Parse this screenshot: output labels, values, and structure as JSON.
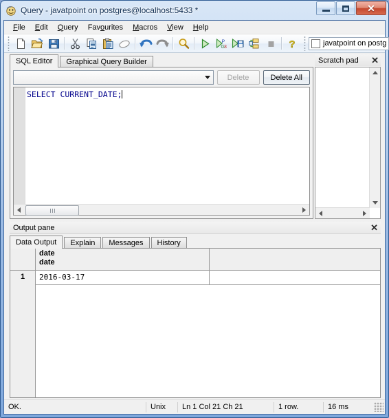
{
  "window": {
    "title": "Query - javatpoint on postgres@localhost:5433 *",
    "icon": "query-window-icon",
    "caption_buttons": [
      {
        "name": "minimize-button",
        "glyph": "minimize"
      },
      {
        "name": "maximize-button",
        "glyph": "maximize"
      },
      {
        "name": "close-button",
        "glyph": "✕"
      }
    ]
  },
  "menubar": {
    "items": [
      {
        "pre": "",
        "accel": "F",
        "post": "ile"
      },
      {
        "pre": "",
        "accel": "E",
        "post": "dit"
      },
      {
        "pre": "",
        "accel": "Q",
        "post": "uery"
      },
      {
        "pre": "Fav",
        "accel": "o",
        "post": "urites"
      },
      {
        "pre": "",
        "accel": "M",
        "post": "acros"
      },
      {
        "pre": "",
        "accel": "V",
        "post": "iew"
      },
      {
        "pre": "",
        "accel": "H",
        "post": "elp"
      }
    ]
  },
  "toolbar": {
    "buttons": [
      {
        "name": "new-file-icon",
        "title": "New"
      },
      {
        "name": "open-file-icon",
        "title": "Open"
      },
      {
        "name": "save-icon",
        "title": "Save"
      },
      {
        "name": "cut-icon",
        "title": "Cut"
      },
      {
        "name": "copy-icon",
        "title": "Copy"
      },
      {
        "name": "paste-icon",
        "title": "Paste"
      },
      {
        "name": "clear-window-icon",
        "title": "Clear window"
      },
      {
        "name": "undo-icon",
        "title": "Undo"
      },
      {
        "name": "redo-icon",
        "title": "Redo"
      },
      {
        "name": "find-replace-icon",
        "title": "Find"
      },
      {
        "name": "execute-query-icon",
        "title": "Execute query"
      },
      {
        "name": "execute-pgscript-icon",
        "title": "Execute pgScript"
      },
      {
        "name": "execute-to-file-icon",
        "title": "Execute to file"
      },
      {
        "name": "explain-query-icon",
        "title": "Explain query"
      },
      {
        "name": "cancel-query-icon",
        "title": "Cancel"
      },
      {
        "name": "help-icon",
        "title": "Help"
      }
    ],
    "database_selector": {
      "label": "javatpoint on postg",
      "checked": false
    }
  },
  "editor_tabs": [
    {
      "label": "SQL Editor",
      "active": true
    },
    {
      "label": "Graphical Query Builder",
      "active": false
    }
  ],
  "query_bar": {
    "combo_value": "",
    "delete_label": "Delete",
    "delete_enabled": false,
    "delete_all_label": "Delete All",
    "delete_all_enabled": true
  },
  "editor": {
    "sql": "SELECT CURRENT_DATE;"
  },
  "scratch_pad": {
    "title": "Scratch pad",
    "close_glyph": "✕",
    "content": ""
  },
  "output_pane": {
    "title": "Output pane",
    "close_glyph": "✕",
    "tabs": [
      {
        "label": "Data Output",
        "active": true
      },
      {
        "label": "Explain",
        "active": false
      },
      {
        "label": "Messages",
        "active": false
      },
      {
        "label": "History",
        "active": false
      }
    ],
    "grid": {
      "column_header": {
        "name": "date",
        "type": "date"
      },
      "rows": [
        {
          "num": "1",
          "value": "2016-03-17"
        }
      ]
    }
  },
  "statusbar": {
    "message": "OK.",
    "line_ending": "Unix",
    "position": "Ln 1 Col 21 Ch 21",
    "rowcount": "1 row.",
    "duration": "16 ms"
  },
  "colors": {
    "frame_blue": "#2f5b93",
    "sql_text": "#00008b",
    "close_red": "#c4482f"
  }
}
